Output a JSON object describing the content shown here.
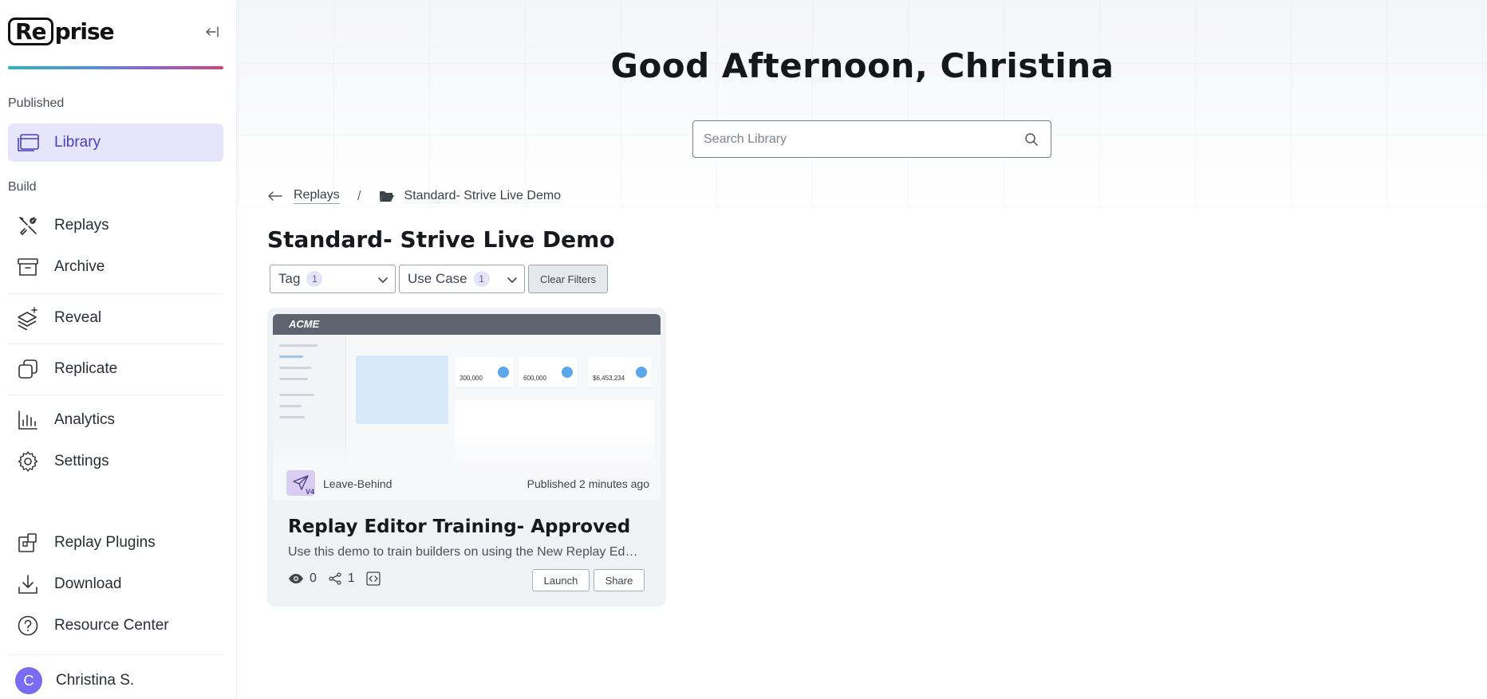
{
  "app": {
    "logo_left": "Re",
    "logo_right": "prise"
  },
  "sidebar": {
    "published_label": "Published",
    "build_label": "Build",
    "items": [
      {
        "label": "Library",
        "icon": "library-icon",
        "active": true
      },
      {
        "label": "Replays",
        "icon": "tools-icon"
      },
      {
        "label": "Archive",
        "icon": "archive-icon"
      },
      {
        "label": "Reveal",
        "icon": "layers-sparkle-icon"
      },
      {
        "label": "Replicate",
        "icon": "copy-icon"
      },
      {
        "label": "Analytics",
        "icon": "bar-chart-icon"
      },
      {
        "label": "Settings",
        "icon": "gear-icon"
      },
      {
        "label": "Replay Plugins",
        "icon": "puzzle-icon"
      },
      {
        "label": "Download",
        "icon": "download-icon"
      },
      {
        "label": "Resource Center",
        "icon": "help-circle-icon"
      }
    ],
    "user": {
      "initial": "C",
      "name": "Christina S."
    },
    "accent_color": "#4a3fbf",
    "active_bg": "#e7e5fb"
  },
  "header": {
    "greeting": "Good Afternoon, Christina",
    "search_placeholder": "Search Library"
  },
  "breadcrumb": {
    "parent": "Replays",
    "separator": "/",
    "current": "Standard- Strive Live Demo"
  },
  "page": {
    "title": "Standard- Strive Live Demo"
  },
  "filters": {
    "tag": {
      "label": "Tag",
      "count": "1"
    },
    "use_case": {
      "label": "Use Case",
      "count": "1"
    },
    "clear_label": "Clear Filters"
  },
  "card": {
    "thumb_brand": "ACME",
    "thumb_stats": [
      "300,000",
      "600,000",
      "$6,453,234"
    ],
    "type_label": "Leave-Behind",
    "type_badge": "V4",
    "published": "Published 2 minutes ago",
    "title": "Replay Editor Training- Approved",
    "description": "Use this demo to train builders on using the New Replay Editor",
    "views": "0",
    "shares": "1",
    "launch_label": "Launch",
    "share_label": "Share"
  }
}
